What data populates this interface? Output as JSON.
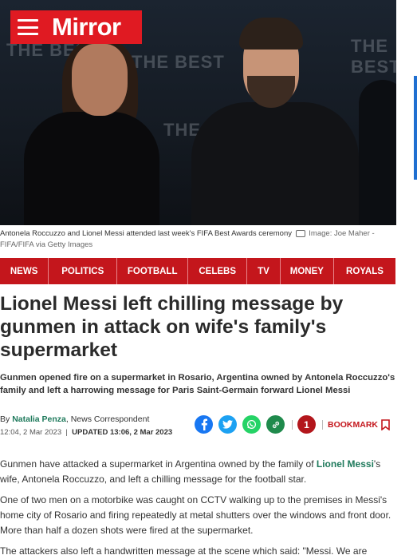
{
  "brand": {
    "logo": "Mirror",
    "logo_color": "#e01a22",
    "accent": "#c4161c",
    "link_color": "#1f7a5c"
  },
  "hero": {
    "backdrop_words": [
      "THE BEST",
      "THE BEST",
      "THE BEST",
      "THE BEST"
    ],
    "caption": "Antonela Roccuzzo and Lionel Messi attended last week's FIFA Best Awards ceremony",
    "credit": "Image: Joe Maher - FIFA/FIFA via Getty Images"
  },
  "nav": {
    "items": [
      "NEWS",
      "POLITICS",
      "FOOTBALL",
      "CELEBS",
      "TV",
      "MONEY",
      "ROYALS"
    ]
  },
  "article": {
    "headline": "Lionel Messi left chilling message by gunmen in attack on wife's family's supermarket",
    "standfirst": "Gunmen opened fire on a supermarket in Rosario, Argentina owned by Antonela Roccuzzo's family and left a harrowing message for Paris Saint-Germain forward Lionel Messi",
    "byline_prefix": "By",
    "author": "Natalia Penza",
    "author_role": ", News Correspondent",
    "published": "12:04, 2 Mar 2023",
    "updated": "UPDATED 13:06, 2 Mar 2023",
    "comments_count": "1",
    "bookmark_label": "BOOKMARK",
    "p1_before": "Gunmen have attacked a supermarket in Argentina owned by the family of ",
    "p1_link": "Lionel Messi",
    "p1_after": "'s wife, Antonela Roccuzzo, and left a chilling message for the football star.",
    "p2": "One of two men on a motorbike was caught on CCTV walking up to the premises in Messi's home city of Rosario and firing repeatedly at metal shutters over the windows and front door. More than half a dozen shots were fired at the supermarket.",
    "p3": "The attackers also left a handwritten message at the scene which said: \"Messi. We are"
  },
  "share_icons": [
    "facebook-icon",
    "twitter-icon",
    "whatsapp-icon",
    "link-icon"
  ],
  "share_colors": [
    "#1877f2",
    "#1da1f2",
    "#25d366",
    "#1f8a4c"
  ]
}
